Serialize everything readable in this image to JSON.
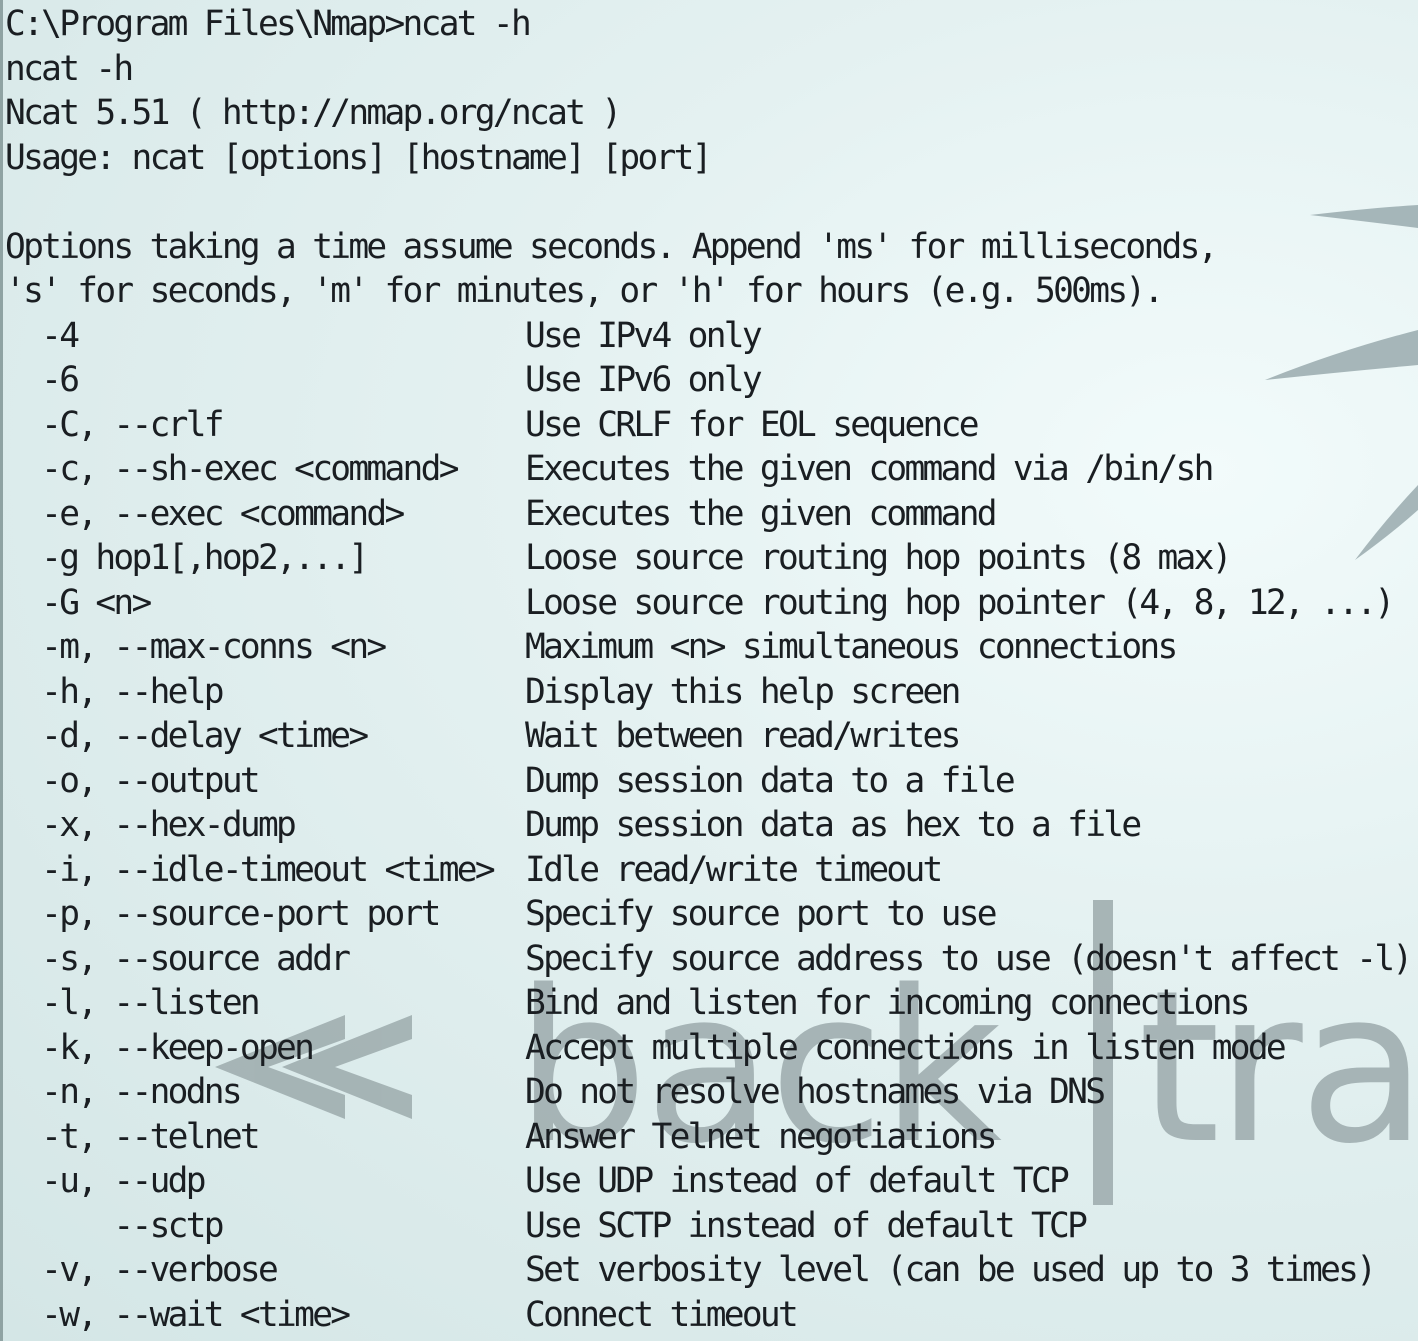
{
  "terminal": {
    "lines": [
      "C:\\Program Files\\Nmap>ncat -h",
      "ncat -h",
      "Ncat 5.51 ( http://nmap.org/ncat )",
      "Usage: ncat [options] [hostname] [port]",
      "",
      "Options taking a time assume seconds. Append 'ms' for milliseconds,",
      "'s' for seconds, 'm' for minutes, or 'h' for hours (e.g. 500ms)."
    ],
    "options": [
      {
        "flag": "  -4",
        "desc": "Use IPv4 only"
      },
      {
        "flag": "  -6",
        "desc": "Use IPv6 only"
      },
      {
        "flag": "  -C, --crlf",
        "desc": "Use CRLF for EOL sequence"
      },
      {
        "flag": "  -c, --sh-exec <command>",
        "desc": "Executes the given command via /bin/sh"
      },
      {
        "flag": "  -e, --exec <command>",
        "desc": "Executes the given command"
      },
      {
        "flag": "  -g hop1[,hop2,...]",
        "desc": "Loose source routing hop points (8 max)"
      },
      {
        "flag": "  -G <n>",
        "desc": "Loose source routing hop pointer (4, 8, 12, ...)"
      },
      {
        "flag": "  -m, --max-conns <n>",
        "desc": "Maximum <n> simultaneous connections"
      },
      {
        "flag": "  -h, --help",
        "desc": "Display this help screen"
      },
      {
        "flag": "  -d, --delay <time>",
        "desc": "Wait between read/writes"
      },
      {
        "flag": "  -o, --output",
        "desc": "Dump session data to a file"
      },
      {
        "flag": "  -x, --hex-dump",
        "desc": "Dump session data as hex to a file"
      },
      {
        "flag": "  -i, --idle-timeout <time>",
        "desc": "Idle read/write timeout"
      },
      {
        "flag": "  -p, --source-port port",
        "desc": "Specify source port to use"
      },
      {
        "flag": "  -s, --source addr",
        "desc": "Specify source address to use (doesn't affect -l)"
      },
      {
        "flag": "  -l, --listen",
        "desc": "Bind and listen for incoming connections"
      },
      {
        "flag": "  -k, --keep-open",
        "desc": "Accept multiple connections in listen mode"
      },
      {
        "flag": "  -n, --nodns",
        "desc": "Do not resolve hostnames via DNS"
      },
      {
        "flag": "  -t, --telnet",
        "desc": "Answer Telnet negotiations"
      },
      {
        "flag": "  -u, --udp",
        "desc": "Use UDP instead of default TCP"
      },
      {
        "flag": "      --sctp",
        "desc": "Use SCTP instead of default TCP"
      },
      {
        "flag": "  -v, --verbose",
        "desc": "Set verbosity level (can be used up to 3 times)"
      },
      {
        "flag": "  -w, --wait <time>",
        "desc": "Connect timeout"
      }
    ]
  },
  "wallpaper": {
    "logo_text": "<< back | track",
    "text_color": "#1a1e22",
    "background_color": "#dcecec",
    "logo_color": "#9aa8aa"
  }
}
